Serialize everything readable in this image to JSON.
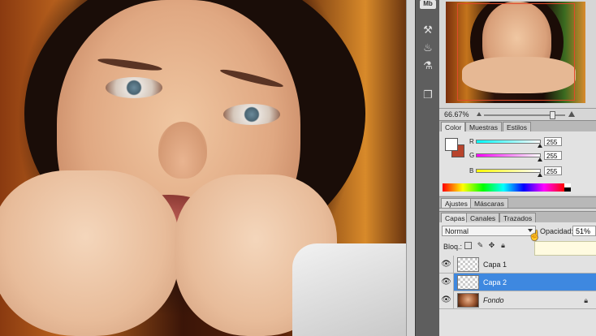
{
  "toolstrip": {
    "mini_bridge_label": "Mb",
    "tools": [
      "brush-presets-icon",
      "clone-source-icon",
      "adjust-icon",
      "layer-comps-icon"
    ]
  },
  "navigator": {
    "zoom": "66.67%"
  },
  "color_tabs": [
    "Color",
    "Muestras",
    "Estilos"
  ],
  "color_panel": {
    "channels": [
      {
        "label": "R",
        "value": "255",
        "gradient": [
          "#00ffff",
          "#ffffff"
        ]
      },
      {
        "label": "G",
        "value": "255",
        "gradient": [
          "#ff00ff",
          "#ffffff"
        ]
      },
      {
        "label": "B",
        "value": "255",
        "gradient": [
          "#ffff00",
          "#ffffff"
        ]
      }
    ],
    "foreground_color": "#ffffff",
    "background_color": "#b8442c"
  },
  "adjust_tabs": [
    "Ajustes",
    "Máscaras"
  ],
  "layers_tabs": [
    "Capas",
    "Canales",
    "Trazados"
  ],
  "layers_panel": {
    "blend_mode": "Normal",
    "opacity_label": "Opacidad:",
    "opacity_value": "51%",
    "lock_label": "Bloq.:",
    "layers": [
      {
        "name": "Capa 1",
        "visible": true,
        "selected": false,
        "thumb": "transparent"
      },
      {
        "name": "Capa 2",
        "visible": true,
        "selected": true,
        "thumb": "transparent"
      },
      {
        "name": "Fondo",
        "visible": true,
        "selected": false,
        "thumb": "photo",
        "locked": true
      }
    ]
  },
  "colors": {
    "selection": "#3e88e0",
    "panel_bg": "#e2e2e2",
    "navigator_view_box": "#e04a2a"
  }
}
